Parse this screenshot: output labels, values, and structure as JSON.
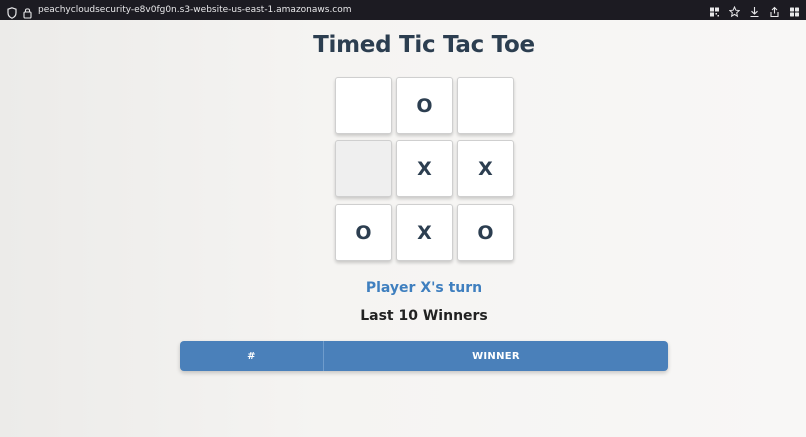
{
  "browser": {
    "url": "peachycloudsecurity-e8v0fg0n.s3-website-us-east-1.amazonaws.com"
  },
  "game": {
    "title": "Timed Tic Tac Toe",
    "board": [
      "",
      "O",
      "",
      "",
      "X",
      "X",
      "O",
      "X",
      "O"
    ],
    "status": "Player X's turn"
  },
  "winners": {
    "heading": "Last 10 Winners",
    "columns": [
      "#",
      "WINNER"
    ]
  },
  "colors": {
    "title": "#2c3e50",
    "status": "#3f7fbf",
    "table_header": "#4a80ba"
  }
}
